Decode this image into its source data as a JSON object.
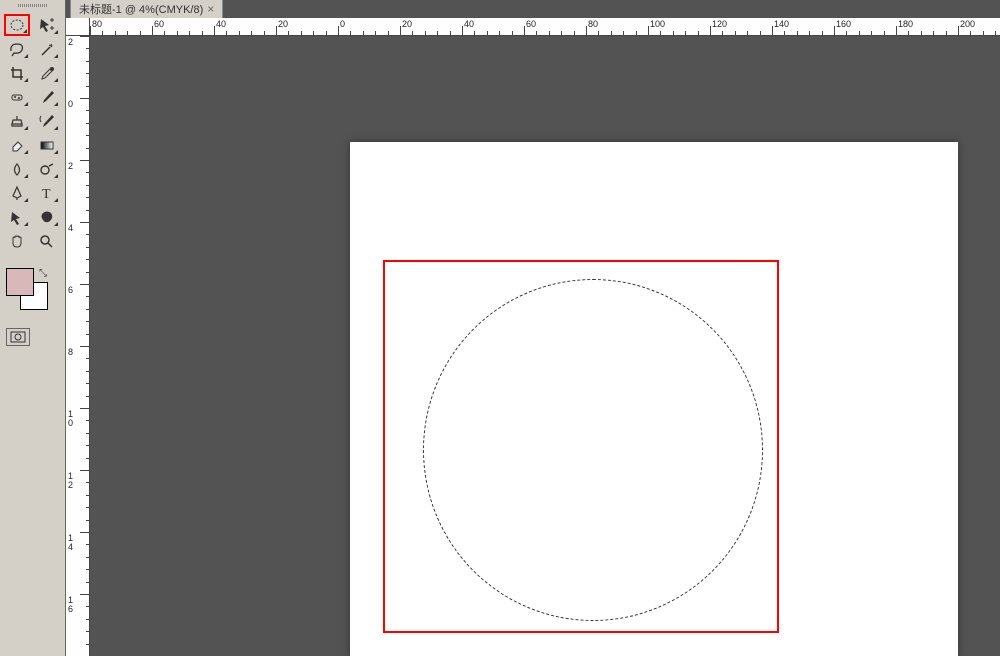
{
  "doc_tab": {
    "label": "未标题-1 @ 4%(CMYK/8)",
    "close": "×"
  },
  "toolbox": {
    "tools": [
      {
        "name": "marquee-ellipse",
        "highlighted": true
      },
      {
        "name": "move"
      },
      {
        "name": "lasso"
      },
      {
        "name": "magic-wand"
      },
      {
        "name": "crop"
      },
      {
        "name": "eyedropper"
      },
      {
        "name": "spot-heal"
      },
      {
        "name": "brush"
      },
      {
        "name": "clone-stamp"
      },
      {
        "name": "history-brush"
      },
      {
        "name": "eraser"
      },
      {
        "name": "gradient"
      },
      {
        "name": "blur"
      },
      {
        "name": "dodge"
      },
      {
        "name": "pen"
      },
      {
        "name": "text"
      },
      {
        "name": "path-select"
      },
      {
        "name": "custom-shape"
      },
      {
        "name": "hand"
      },
      {
        "name": "zoom"
      }
    ],
    "fg_color": "#d8b8b8",
    "bg_color": "#ffffff"
  },
  "ruler": {
    "h_ticks": [
      "80",
      "60",
      "40",
      "20",
      "0",
      "20",
      "40",
      "60",
      "80",
      "100",
      "120",
      "140",
      "160",
      "180",
      "200"
    ],
    "v_ticks": [
      "2",
      "0",
      "2",
      "4",
      "6",
      "8",
      "10",
      "12",
      "14",
      "16"
    ]
  },
  "annotations": {
    "tool_highlight": "red",
    "canvas_highlight": "red"
  }
}
